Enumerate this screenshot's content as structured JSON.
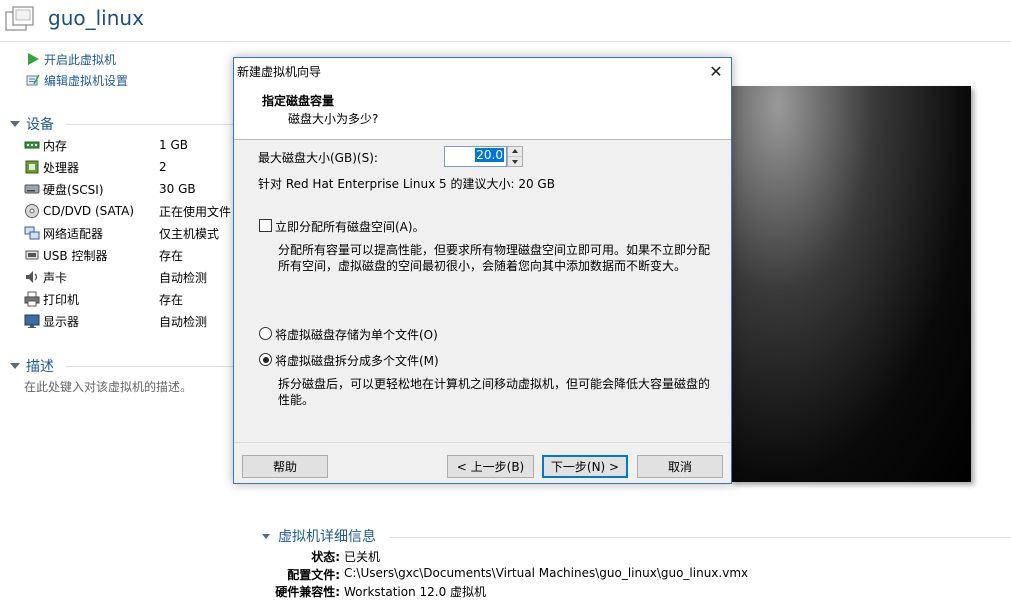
{
  "vm": {
    "title": "guo_linux"
  },
  "actions": [
    {
      "label": "开启此虚拟机",
      "icon": "play-icon"
    },
    {
      "label": "编辑虚拟机设置",
      "icon": "edit-settings-icon"
    }
  ],
  "devices": {
    "heading": "设备",
    "items": [
      {
        "name": "内存",
        "value": "1 GB",
        "icon": "memory-icon"
      },
      {
        "name": "处理器",
        "value": "2",
        "icon": "processor-icon"
      },
      {
        "name": "硬盘(SCSI)",
        "value": "30 GB",
        "icon": "hard-disk-icon"
      },
      {
        "name": "CD/DVD (SATA)",
        "value": "正在使用文件 E:..",
        "icon": "cd-dvd-icon"
      },
      {
        "name": "网络适配器",
        "value": "仅主机模式",
        "icon": "network-adapter-icon"
      },
      {
        "name": "USB 控制器",
        "value": "存在",
        "icon": "usb-icon"
      },
      {
        "name": "声卡",
        "value": "自动检测",
        "icon": "sound-card-icon"
      },
      {
        "name": "打印机",
        "value": "存在",
        "icon": "printer-icon"
      },
      {
        "name": "显示器",
        "value": "自动检测",
        "icon": "display-icon"
      }
    ]
  },
  "description": {
    "heading": "描述",
    "placeholder": "在此处键入对该虚拟机的描述。"
  },
  "details": {
    "heading": "虚拟机详细信息",
    "rows": [
      {
        "label": "状态:",
        "value": "已关机"
      },
      {
        "label": "配置文件:",
        "value": "C:\\Users\\gxc\\Documents\\Virtual Machines\\guo_linux\\guo_linux.vmx"
      },
      {
        "label": "硬件兼容性:",
        "value": "Workstation 12.0 虚拟机"
      }
    ]
  },
  "dialog": {
    "title": "新建虚拟机向导",
    "close_label": "✕",
    "heading": "指定磁盘容量",
    "subheading": "磁盘大小为多少?",
    "max_size_label": "最大磁盘大小(GB)(S):",
    "max_size_value": "20.0",
    "recommend_text": "针对 Red Hat Enterprise Linux 5 的建议大小: 20 GB",
    "allocate_now": {
      "label": "立即分配所有磁盘空间(A)。",
      "checked": false
    },
    "allocate_desc_line1": "分配所有容量可以提高性能，但要求所有物理磁盘空间立即可用。如果不立即分配",
    "allocate_desc_line2": "所有空间，虚拟磁盘的空间最初很小，会随着您向其中添加数据而不断变大。",
    "single_file": {
      "label": "将虚拟磁盘存储为单个文件(O)",
      "selected": false
    },
    "multi_file": {
      "label": "将虚拟磁盘拆分成多个文件(M)",
      "selected": true
    },
    "split_desc_line1": "拆分磁盘后，可以更轻松地在计算机之间移动虚拟机，但可能会降低大容量磁盘的",
    "split_desc_line2": "性能。",
    "buttons": {
      "help": "帮助",
      "back": "< 上一步(B)",
      "next": "下一步(N) >",
      "cancel": "取消"
    }
  }
}
